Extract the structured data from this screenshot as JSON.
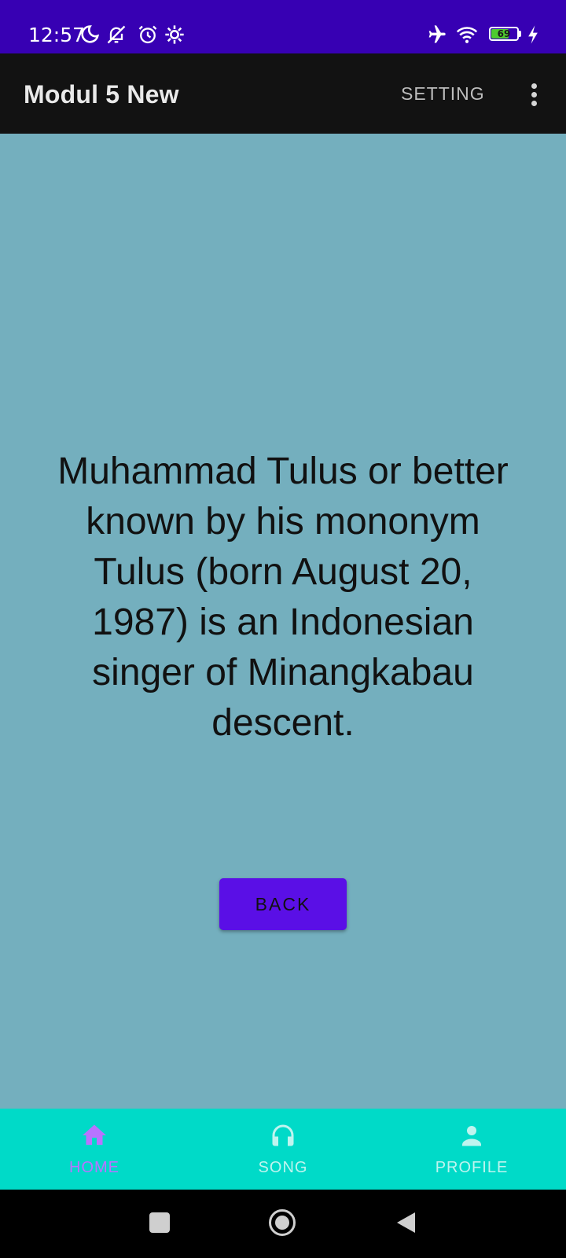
{
  "status_bar": {
    "time": "12:57",
    "battery_level": "69",
    "icons": [
      "moon-icon",
      "notifications-off-icon",
      "alarm-icon",
      "gear-icon",
      "airplane-icon",
      "wifi-icon",
      "battery-icon",
      "charging-icon"
    ]
  },
  "app_bar": {
    "title": "Modul 5 New",
    "setting_label": "SETTING",
    "overflow_icon": "more-vert-icon"
  },
  "content": {
    "description": "Muhammad Tulus or better known by his mononym Tulus (born August 20, 1987) is an Indonesian singer of Minangkabau descent.",
    "back_label": "BACK"
  },
  "bottom_nav": {
    "items": [
      {
        "label": "HOME",
        "icon": "home-icon",
        "active": true
      },
      {
        "label": "SONG",
        "icon": "headphones-icon",
        "active": false
      },
      {
        "label": "PROFILE",
        "icon": "person-icon",
        "active": false
      }
    ]
  },
  "system_nav": {
    "buttons": [
      "recents-icon",
      "home-circle-icon",
      "back-triangle-icon"
    ]
  },
  "colors": {
    "status_bar": "#3700b3",
    "app_bar": "#121212",
    "background": "#74afbe",
    "back_button": "#5a0fe6",
    "bottom_nav": "#00dac8",
    "nav_active": "#b873ff",
    "nav_inactive": "#bff4ef"
  }
}
